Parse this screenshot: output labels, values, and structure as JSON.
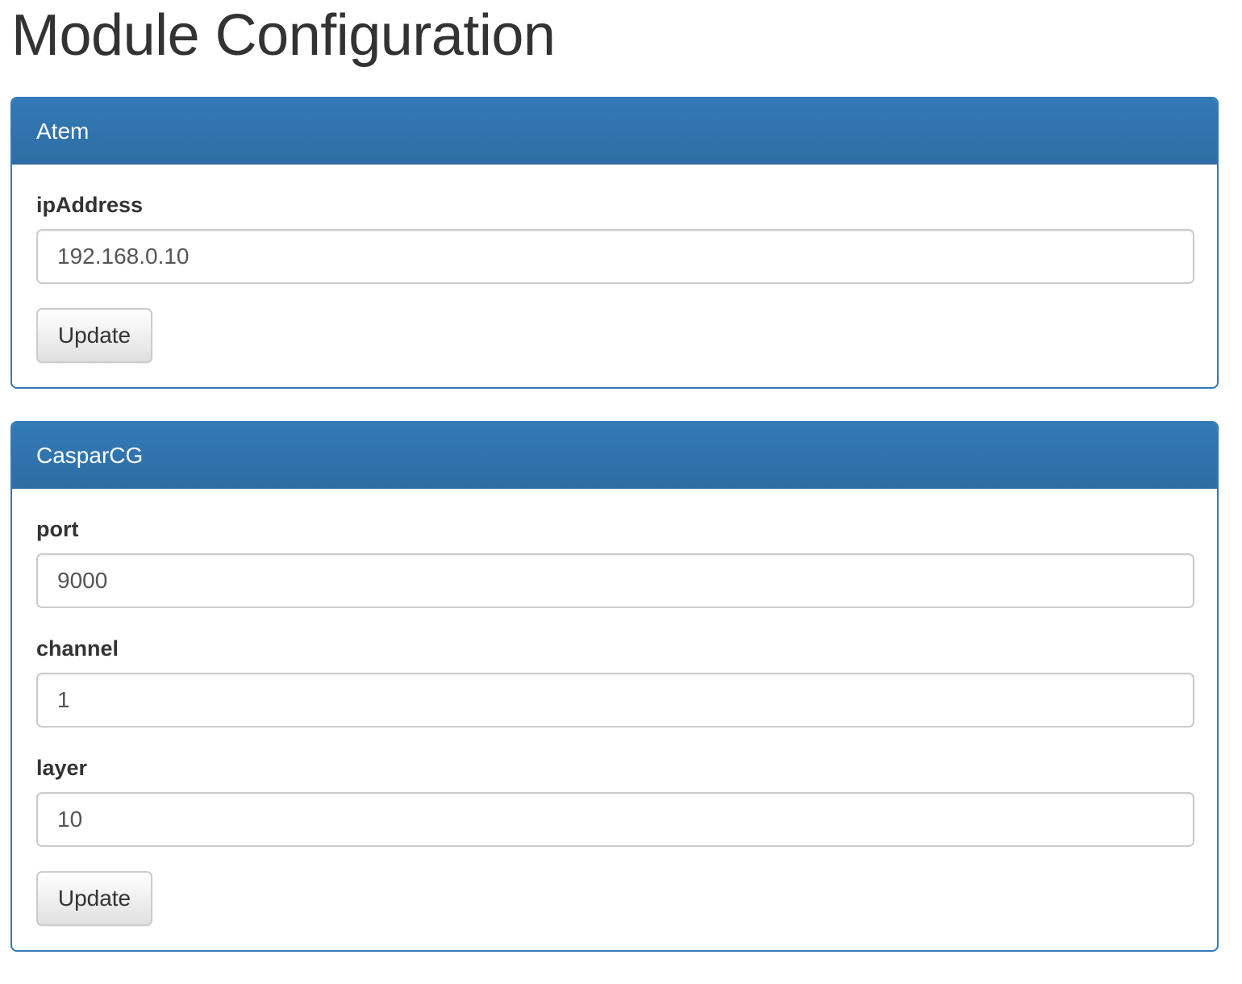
{
  "page": {
    "title": "Module Configuration"
  },
  "panels": {
    "atem": {
      "heading": "Atem",
      "fields": {
        "ip_address": {
          "label": "ipAddress",
          "value": "192.168.0.10"
        }
      },
      "update_label": "Update"
    },
    "casparcg": {
      "heading": "CasparCG",
      "fields": {
        "port": {
          "label": "port",
          "value": "9000"
        },
        "channel": {
          "label": "channel",
          "value": "1"
        },
        "layer": {
          "label": "layer",
          "value": "10"
        }
      },
      "update_label": "Update"
    }
  },
  "colors": {
    "panel_primary": "#337ab7",
    "heading_text": "#ffffff",
    "input_border": "#cccccc",
    "body_text": "#333333"
  }
}
